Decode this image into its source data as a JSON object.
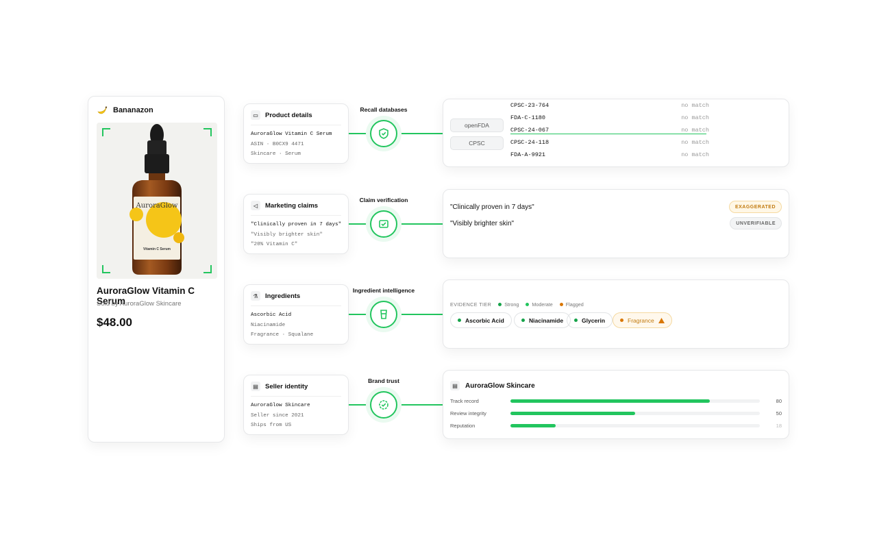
{
  "store": {
    "name": "Bananazon"
  },
  "product": {
    "title": "AuroraGlow Vitamin C Serum",
    "seller": "Sold by AuroraGlow Skincare",
    "price": "$48.00",
    "label_brand": "AuroraGlow",
    "label_name": "Vitamin C Serum"
  },
  "sections": [
    {
      "title": "Product details",
      "icon": "box-icon",
      "lines": [
        "AuroraGlow Vitamin C Serum",
        "ASIN · B0CX9 4471",
        "Skincare · Serum"
      ],
      "node_label": "Recall databases",
      "node_icon": "shield-check-icon"
    },
    {
      "title": "Marketing claims",
      "icon": "megaphone-icon",
      "lines": [
        "\"Clinically proven in 7 days\"",
        "\"Visibly brighter skin\"",
        "\"20% Vitamin C\""
      ],
      "node_label": "Claim verification",
      "node_icon": "checklist-icon"
    },
    {
      "title": "Ingredients",
      "icon": "flask-icon",
      "lines": [
        "Ascorbic Acid",
        "Niacinamide",
        "Fragrance · Squalane"
      ],
      "node_label": "Ingredient intelligence",
      "node_icon": "beaker-icon"
    },
    {
      "title": "Seller identity",
      "icon": "store-icon",
      "lines": [
        "AuroraGlow Skincare",
        "Seller since 2021",
        "Ships from US"
      ],
      "node_label": "Brand trust",
      "node_icon": "verified-badge-icon"
    }
  ],
  "recall": {
    "sources": [
      "openFDA",
      "CPSC"
    ],
    "rows": [
      {
        "id": "CPSC-23-764",
        "status": "no match"
      },
      {
        "id": "FDA-C-1180",
        "status": "no match"
      },
      {
        "id": "CPSC-24-067",
        "status": "no match"
      },
      {
        "id": "CPSC-24-118",
        "status": "no match"
      },
      {
        "id": "FDA-A-9921",
        "status": "no match"
      }
    ]
  },
  "claims": [
    {
      "text": "\"Clinically proven in 7 days\"",
      "tag": "EXAGGERATED"
    },
    {
      "text": "\"Visibly brighter skin\"",
      "tag": "UNVERIFIABLE"
    }
  ],
  "evidence": {
    "label": "EVIDENCE TIER",
    "tiers": [
      {
        "name": "Strong",
        "color": "#16a34a"
      },
      {
        "name": "Moderate",
        "color": "#22c55e"
      },
      {
        "name": "Flagged",
        "color": "#d97706"
      }
    ],
    "chips": [
      {
        "name": "Ascorbic Acid",
        "tier": "Strong"
      },
      {
        "name": "Niacinamide",
        "tier": "Strong"
      },
      {
        "name": "Glycerin",
        "tier": "Strong"
      },
      {
        "name": "Fragrance",
        "tier": "Flagged"
      }
    ]
  },
  "brand": {
    "name": "AuroraGlow Skincare",
    "metrics": [
      {
        "label": "Track record",
        "value": 80
      },
      {
        "label": "Review integrity",
        "value": 50
      },
      {
        "label": "Reputation",
        "value": 18
      }
    ]
  },
  "colors": {
    "accent": "#22c55e",
    "flag": "#d97706"
  }
}
